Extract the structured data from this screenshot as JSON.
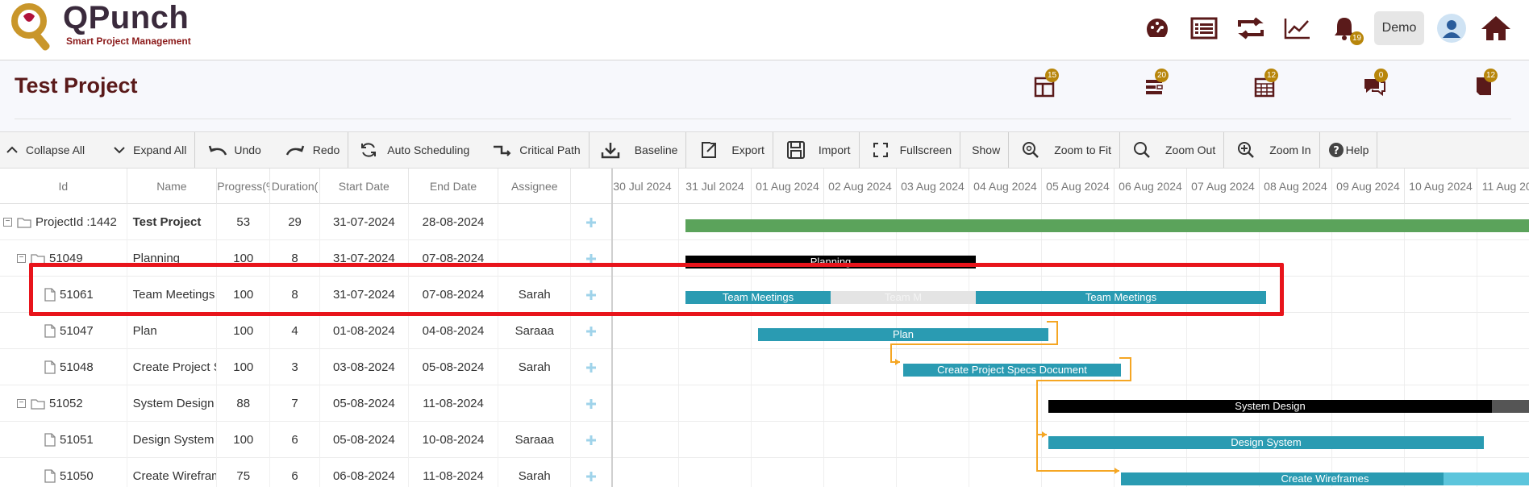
{
  "header": {
    "logo_title": "QPunch",
    "logo_subtitle": "Smart Project Management",
    "notifications_count": "19",
    "demo_label": "Demo"
  },
  "project": {
    "title": "Test Project",
    "icon_badges": [
      "15",
      "20",
      "12",
      "0",
      "12"
    ]
  },
  "toolbar": {
    "collapse_all": "Collapse All",
    "expand_all": "Expand All",
    "undo": "Undo",
    "redo": "Redo",
    "auto_scheduling": "Auto Scheduling",
    "critical_path": "Critical Path",
    "baseline": "Baseline",
    "export": "Export",
    "import": "Import",
    "fullscreen": "Fullscreen",
    "show": "Show",
    "zoom_to_fit": "Zoom to Fit",
    "zoom_out": "Zoom Out",
    "zoom_in": "Zoom In",
    "help": "Help"
  },
  "grid": {
    "columns": [
      "Id",
      "Name",
      "Progress(%",
      "Duration(",
      "Start Date",
      "End Date",
      "Assignee"
    ],
    "rows": [
      {
        "id": "ProjectId :1442",
        "name": "Test Project",
        "progress": "53",
        "duration": "29",
        "start": "31-07-2024",
        "end": "28-08-2024",
        "assignee": ""
      },
      {
        "id": "51049",
        "name": "Planning",
        "progress": "100",
        "duration": "8",
        "start": "31-07-2024",
        "end": "07-08-2024",
        "assignee": ""
      },
      {
        "id": "51061",
        "name": "Team Meetings",
        "progress": "100",
        "duration": "8",
        "start": "31-07-2024",
        "end": "07-08-2024",
        "assignee": "Sarah"
      },
      {
        "id": "51047",
        "name": "Plan",
        "progress": "100",
        "duration": "4",
        "start": "01-08-2024",
        "end": "04-08-2024",
        "assignee": "Saraaa"
      },
      {
        "id": "51048",
        "name": "Create Project S",
        "progress": "100",
        "duration": "3",
        "start": "03-08-2024",
        "end": "05-08-2024",
        "assignee": "Sarah"
      },
      {
        "id": "51052",
        "name": "System Design",
        "progress": "88",
        "duration": "7",
        "start": "05-08-2024",
        "end": "11-08-2024",
        "assignee": ""
      },
      {
        "id": "51051",
        "name": "Design System",
        "progress": "100",
        "duration": "6",
        "start": "05-08-2024",
        "end": "10-08-2024",
        "assignee": "Saraaa"
      },
      {
        "id": "51050",
        "name": "Create Wirefram",
        "progress": "75",
        "duration": "6",
        "start": "06-08-2024",
        "end": "11-08-2024",
        "assignee": "Sarah"
      }
    ]
  },
  "chart": {
    "days": [
      "30 Jul 2024",
      "31 Jul 2024",
      "01 Aug 2024",
      "02 Aug 2024",
      "03 Aug 2024",
      "04 Aug 2024",
      "05 Aug 2024",
      "06 Aug 2024",
      "07 Aug 2024",
      "08 Aug 2024",
      "09 Aug 2024",
      "10 Aug 2024",
      "11 Aug 2024"
    ],
    "bars": {
      "planning": "Planning",
      "team_meetings_a": "Team Meetings",
      "team_meetings_mid": "Team M",
      "team_meetings_b": "Team Meetings",
      "plan": "Plan",
      "create_specs": "Create Project Specs Document",
      "system_design": "System Design",
      "design_system": "Design System",
      "create_wireframes": "Create Wireframes"
    },
    "colors": {
      "project": "#5ba35b",
      "summary": "#000000",
      "task": "#2a9bb2",
      "link": "#f5a623",
      "highlight": "#e8141b"
    }
  }
}
